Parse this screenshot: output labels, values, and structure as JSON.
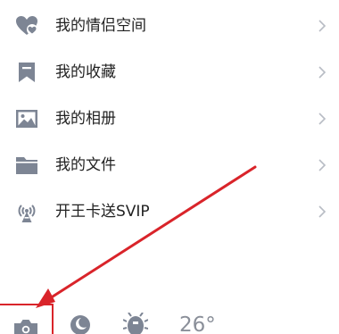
{
  "menu": {
    "items": [
      {
        "label": "我的情侣空间",
        "icon": "heart-icon"
      },
      {
        "label": "我的收藏",
        "icon": "bookmark-icon"
      },
      {
        "label": "我的相册",
        "icon": "photo-album-icon"
      },
      {
        "label": "我的文件",
        "icon": "folder-icon"
      },
      {
        "label": "开王卡送SVIP",
        "icon": "signal-tower-icon"
      }
    ]
  },
  "bottom_bar": {
    "temperature": "26°",
    "icons": [
      "camera-icon",
      "moon-icon",
      "bug-icon"
    ]
  },
  "colors": {
    "icon_gray": "#7d8594",
    "text": "#222222",
    "chevron": "#b8bcc4",
    "annotation_red": "#d9242a"
  }
}
